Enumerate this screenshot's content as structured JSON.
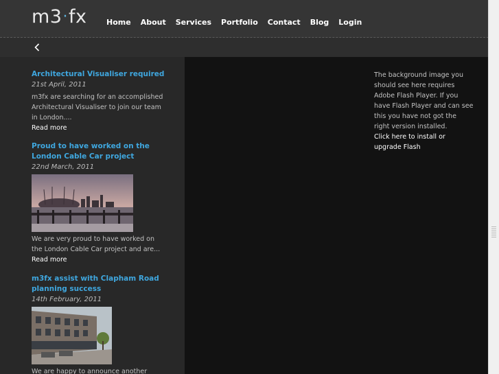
{
  "header": {
    "logo": {
      "left": "m3",
      "dot": "·",
      "right": "fx"
    },
    "nav": [
      "Home",
      "About",
      "Services",
      "Portfolio",
      "Contact",
      "Blog",
      "Login"
    ]
  },
  "posts": [
    {
      "title": "Architectural Visualiser required",
      "date": "21st April, 2011",
      "excerpt": "m3fx are searching for an accomplished Architectural Visualiser to join our team in London....",
      "more": "Read more"
    },
    {
      "title": "Proud to have worked on the London Cable Car project",
      "date": "22nd March, 2011",
      "excerpt": "We are very proud to have worked on the London Cable Car project and are...",
      "more": "Read more"
    },
    {
      "title": "m3fx assist with Clapham Road planning success",
      "date": "14th February, 2011",
      "excerpt": "We are happy to announce another"
    }
  ],
  "flash": {
    "message": "The background image you should see here requires Adobe Flash Player. If you have Flash Player and can see this you have not got the right version installed.",
    "link": "Click here to install or upgrade Flash"
  },
  "colors": {
    "accent": "#3fa7df",
    "header_bg": "#353535",
    "sidebar_bg": "#282828",
    "page_bg": "#121212"
  }
}
